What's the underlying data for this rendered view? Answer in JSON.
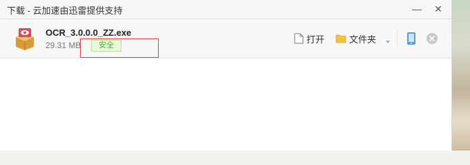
{
  "window": {
    "title": "下载 - 云加速由迅雷提供支持"
  },
  "titlebar": {
    "minimize_glyph": "—",
    "close_glyph": "✕"
  },
  "download": {
    "file_name": "OCR_3.0.0.0_ZZ.exe",
    "file_size": "29.31 MB",
    "safety_badge": "安全",
    "actions": {
      "open_label": "打开",
      "folder_label": "文件夹"
    }
  },
  "icons": [
    "file-package-icon",
    "document-icon",
    "folder-icon",
    "chevron-down-icon",
    "phone-icon",
    "close-circle-icon",
    "minimize-icon",
    "close-icon"
  ],
  "colors": {
    "badge_bg": "#e9f7df",
    "badge_text": "#59a83a",
    "highlight": "#e23b3b",
    "folder": "#f5c142"
  }
}
